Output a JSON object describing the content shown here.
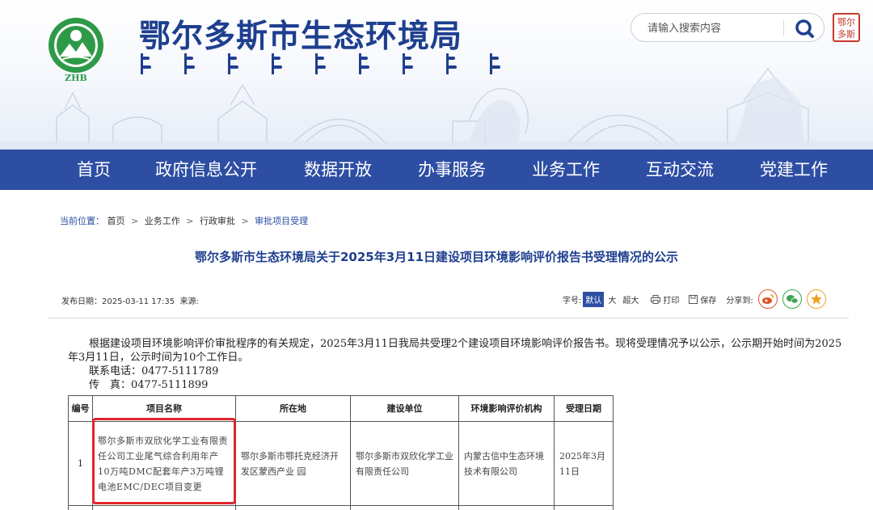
{
  "header": {
    "site_title": "鄂尔多斯市生态环境局",
    "logo_text": "ZHB",
    "seal_text": "鄂尔多斯",
    "search": {
      "placeholder": "请输入搜索内容"
    }
  },
  "nav": {
    "items": [
      {
        "label": "首页"
      },
      {
        "label": "政府信息公开"
      },
      {
        "label": "数据开放"
      },
      {
        "label": "办事服务"
      },
      {
        "label": "业务工作"
      },
      {
        "label": "互动交流"
      },
      {
        "label": "党建工作"
      }
    ]
  },
  "breadcrumb": {
    "label": "当前位置：",
    "items": [
      "首页",
      "业务工作",
      "行政审批",
      "审批项目受理"
    ],
    "separator": ">"
  },
  "article": {
    "title": "鄂尔多斯市生态环境局关于2025年3月11日建设项目环境影响评价报告书受理情况的公示",
    "publish_label": "发布日期：",
    "publish_date": "2025-03-11 17:35",
    "source_label": "来源:",
    "font_label": "字号:",
    "font_sizes": [
      "默认",
      "大",
      "超大"
    ],
    "print_label": "打印",
    "save_label": "保存",
    "share_label": "分享到:",
    "paragraph_1": "根据建设项目环境影响评价审批程序的有关规定，2025年3月11日我局共受理2个建设项目环境影响评价报告书。现将受理情况予以公示，公示期开始时间为2025年3月11日，公示时间为10个工作日。",
    "phone": "联系电话：0477-5111789",
    "fax": "传　真：0477-5111899"
  },
  "table": {
    "headers": {
      "no": "编号",
      "project": "项目名称",
      "location": "所在地",
      "builder": "建设单位",
      "eia_org": "环境影响评价机构",
      "date": "受理日期"
    },
    "rows": [
      {
        "no": "1",
        "project": "鄂尔多斯市双欣化学工业有限责任公司工业尾气综合利用年产10万吨DMC配套年产3万吨锂电池EMC/DEC项目变更",
        "location": "鄂尔多斯市鄂托克经济开发区蒙西产业 园",
        "builder": "鄂尔多斯市双欣化学工业有限责任公司",
        "eia_org": "内蒙古信中生态环境技术有限公司",
        "date": "2025年3月11日"
      }
    ]
  },
  "colors": {
    "nav_bg": "#2d4ea3",
    "title_blue": "#1e3f8f",
    "highlight_red": "#e3242b"
  }
}
